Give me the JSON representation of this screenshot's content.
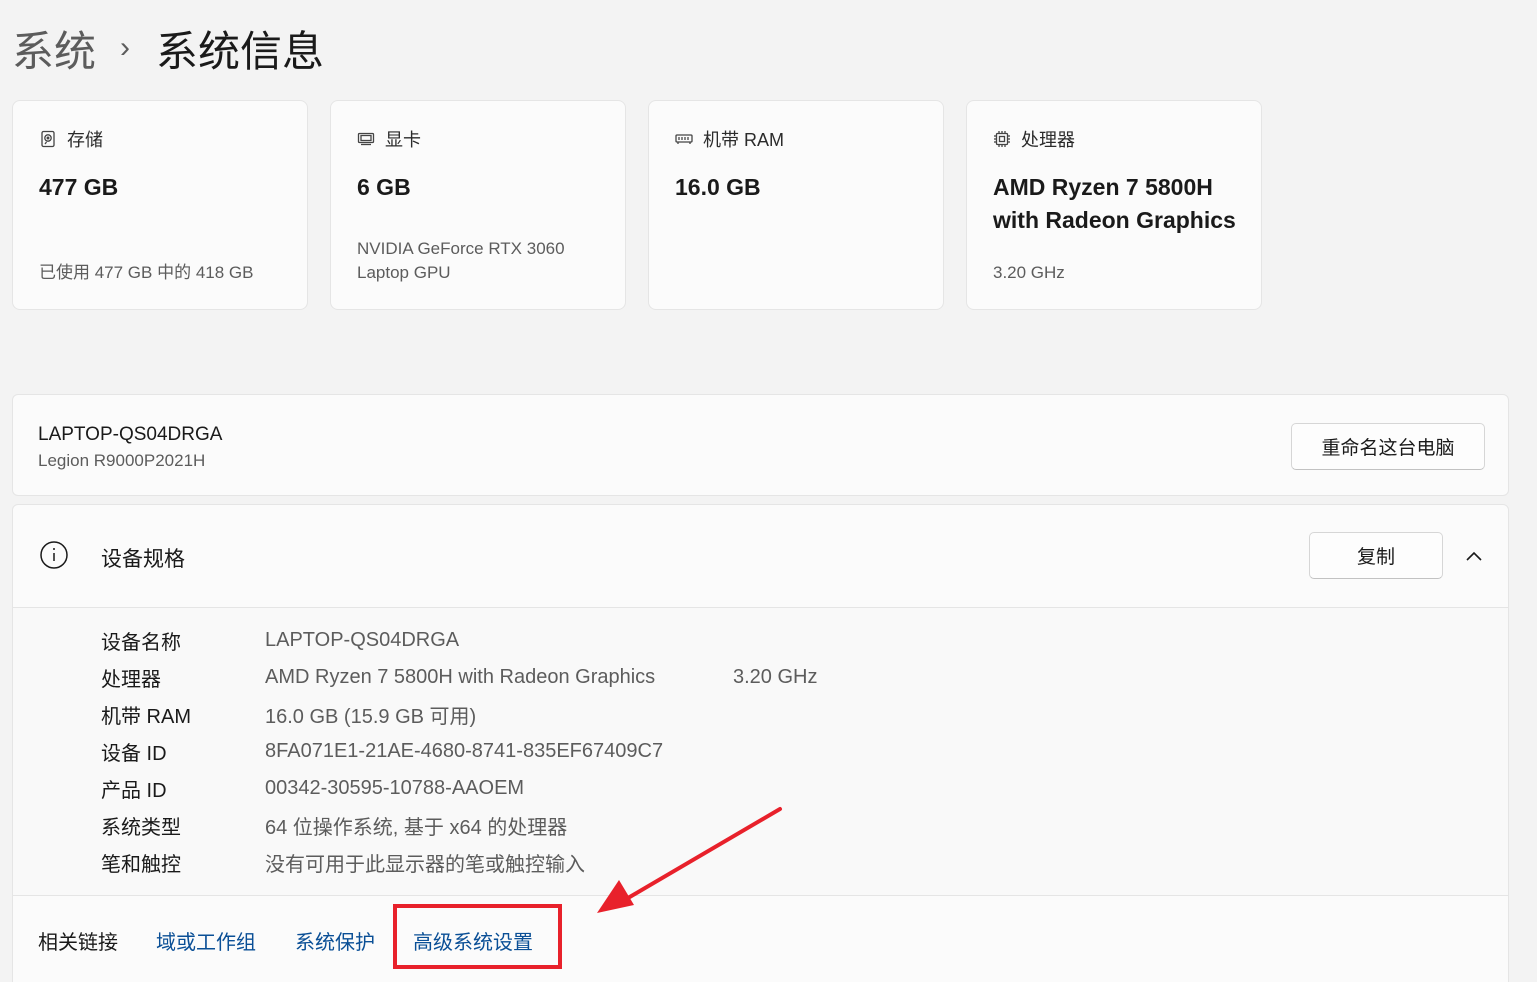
{
  "breadcrumb": {
    "parent": "系统",
    "separator": "›",
    "current": "系统信息"
  },
  "cards": {
    "storage": {
      "icon": "storage-drive-icon",
      "label": "存储",
      "value": "477 GB",
      "sub": "已使用 477 GB 中的 418 GB"
    },
    "gpu": {
      "icon": "display-adapter-icon",
      "label": "显卡",
      "value": "6 GB",
      "sub1": "NVIDIA GeForce RTX 3060",
      "sub2": "Laptop GPU"
    },
    "ram": {
      "icon": "memory-icon",
      "label": "机带 RAM",
      "value": "16.0 GB"
    },
    "cpu": {
      "icon": "processor-chip-icon",
      "label": "处理器",
      "value1": "AMD Ryzen 7 5800H",
      "value2": "with Radeon Graphics",
      "sub": "3.20 GHz"
    }
  },
  "pc": {
    "name": "LAPTOP-QS04DRGA",
    "model": "Legion R9000P2021H",
    "rename_label": "重命名这台电脑"
  },
  "specs": {
    "title": "设备规格",
    "copy_label": "复制",
    "rows": [
      {
        "key": "设备名称",
        "value": "LAPTOP-QS04DRGA"
      },
      {
        "key": "处理器",
        "value": "AMD Ryzen 7 5800H with Radeon Graphics",
        "extra": "3.20 GHz"
      },
      {
        "key": "机带 RAM",
        "value": "16.0 GB (15.9 GB 可用)"
      },
      {
        "key": "设备 ID",
        "value": "8FA071E1-21AE-4680-8741-835EF67409C7"
      },
      {
        "key": "产品 ID",
        "value": "00342-30595-10788-AAOEM"
      },
      {
        "key": "系统类型",
        "value": "64 位操作系统, 基于 x64 的处理器"
      },
      {
        "key": "笔和触控",
        "value": "没有可用于此显示器的笔或触控输入"
      }
    ]
  },
  "related": {
    "label": "相关链接",
    "links": [
      "域或工作组",
      "系统保护",
      "高级系统设置"
    ]
  },
  "colors": {
    "accent_link": "#0a4f96",
    "annotation_red": "#e8212b",
    "background": "#f3f3f3",
    "card": "#fbfbfb"
  }
}
